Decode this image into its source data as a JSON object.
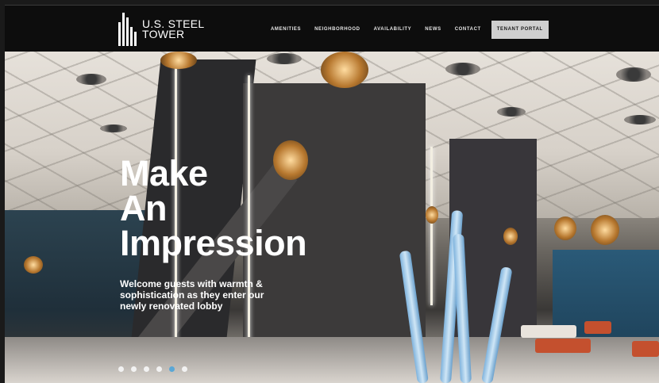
{
  "logo": {
    "line1": "U.S. STEEL",
    "line2": "TOWER"
  },
  "nav": {
    "items": [
      "AMENITIES",
      "NEIGHBORHOOD",
      "AVAILABILITY",
      "NEWS",
      "CONTACT"
    ],
    "portal": "TENANT PORTAL"
  },
  "hero": {
    "headline": [
      "Make",
      "An",
      "Impression"
    ],
    "subtitle": "Welcome guests with warmth & sophistication as they enter our newly renovated lobby"
  },
  "slider": {
    "count": 6,
    "active_index": 4,
    "active_color": "#5aa7d6"
  },
  "colors": {
    "header_bg": "#0d0d0d",
    "portal_bg": "#cfcfcf",
    "text": "#ffffff"
  }
}
